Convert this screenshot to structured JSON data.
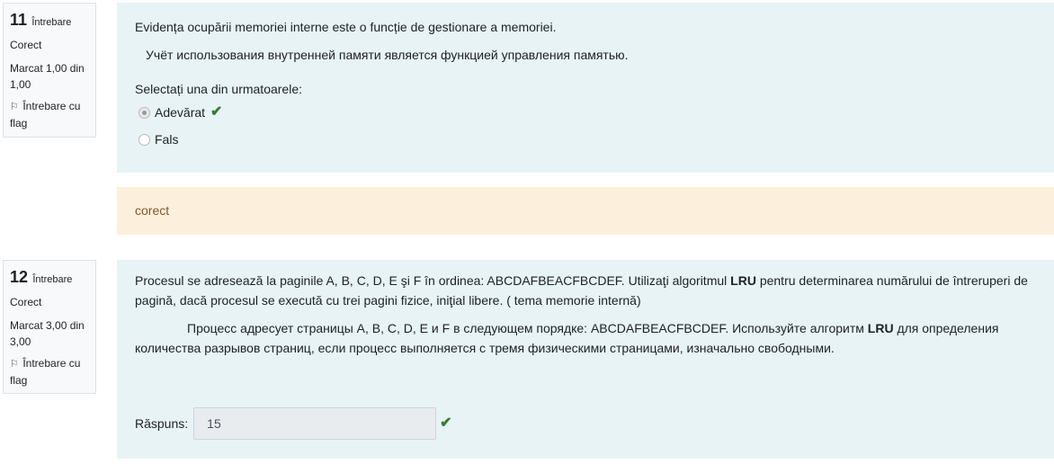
{
  "q11": {
    "number": "11",
    "question_word": "Întrebare",
    "state": "Corect",
    "grade": "Marcat 1,00 din 1,00",
    "flag_label": "Întrebare cu flag",
    "text_ro": "Evidența ocupării memoriei interne este o funcție de gestionare a memoriei.",
    "text_ru": "Учёт использования внутренней памяти является функцией управления памятью.",
    "prompt": "Selectați una din urmatoarele:",
    "options": [
      {
        "label": "Adevărat",
        "selected": true,
        "correct": true
      },
      {
        "label": "Fals",
        "selected": false,
        "correct": false
      }
    ],
    "feedback": "corect"
  },
  "q12": {
    "number": "12",
    "question_word": "Întrebare",
    "state": "Corect",
    "grade": "Marcat 3,00 din 3,00",
    "flag_label": "Întrebare cu flag",
    "ro_part1": "Procesul se adresează la paginile A, B, C, D, E şi F în ordinea:  ABCDAFBEACFBCDEF. Utilizaţi algoritmul ",
    "ro_bold": "LRU",
    "ro_part2": " pentru determinarea numărului de întreruperi de pagină, dacă procesul se execută cu trei pagini fizice, iniţial libere.       ( tema memorie internă)",
    "ru_part1": "Процесс адресует страницы A, B, C, D, E и F в следующем порядке: ABCDAFBEACFBCDEF. Используйте алгоритм ",
    "ru_bold": "LRU",
    "ru_part2": " для определения количества разрывов страниц, если процесс выполняется с тремя физическими страницами, изначально свободными.",
    "answer_label": "Răspuns:",
    "answer_value": "15"
  },
  "colors": {
    "content_bg": "#e7f3f5",
    "feedback_bg": "#fcefdc",
    "feedback_text": "#7d5a29",
    "correct_tick": "#357a32"
  },
  "icons": {
    "flag": "flag-icon",
    "tick": "check-icon"
  }
}
